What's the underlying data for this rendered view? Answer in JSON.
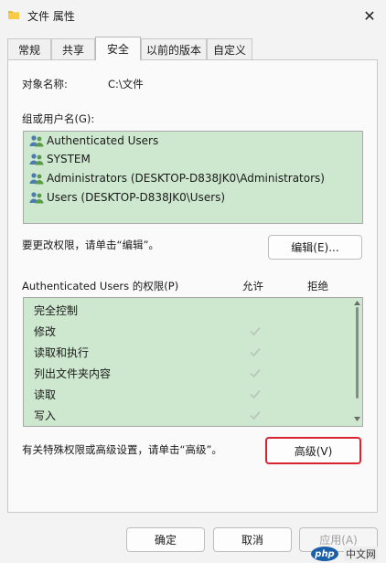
{
  "window": {
    "title": "文件 属性",
    "close_glyph": "✕"
  },
  "tabs": [
    {
      "label": "常规",
      "active": false
    },
    {
      "label": "共享",
      "active": false
    },
    {
      "label": "安全",
      "active": true
    },
    {
      "label": "以前的版本",
      "active": false
    },
    {
      "label": "自定义",
      "active": false
    }
  ],
  "object": {
    "label": "对象名称:",
    "value": "C:\\文件"
  },
  "groups": {
    "label": "组或用户名(G):",
    "items": [
      "Authenticated Users",
      "SYSTEM",
      "Administrators (DESKTOP-D838JK0\\Administrators)",
      "Users (DESKTOP-D838JK0\\Users)"
    ],
    "icon": "users-group-icon"
  },
  "edit": {
    "hint": "要更改权限，请单击“编辑”。",
    "button": "编辑(E)..."
  },
  "permissions": {
    "label": "Authenticated Users 的权限(P)",
    "allow_header": "允许",
    "deny_header": "拒绝",
    "rows": [
      {
        "name": "完全控制",
        "allow": false
      },
      {
        "name": "修改",
        "allow": true
      },
      {
        "name": "读取和执行",
        "allow": true
      },
      {
        "name": "列出文件夹内容",
        "allow": true
      },
      {
        "name": "读取",
        "allow": true
      },
      {
        "name": "写入",
        "allow": true
      }
    ]
  },
  "advanced": {
    "hint": "有关特殊权限或高级设置，请单击“高级”。",
    "button": "高级(V)"
  },
  "footer": {
    "ok": "确定",
    "cancel": "取消",
    "apply": "应用(A)"
  },
  "watermark": {
    "logo": "php",
    "text": "中文网"
  },
  "colors": {
    "list_bg": "#cde8cf",
    "highlight": "#d9232e",
    "check": "#b9c7ba"
  }
}
